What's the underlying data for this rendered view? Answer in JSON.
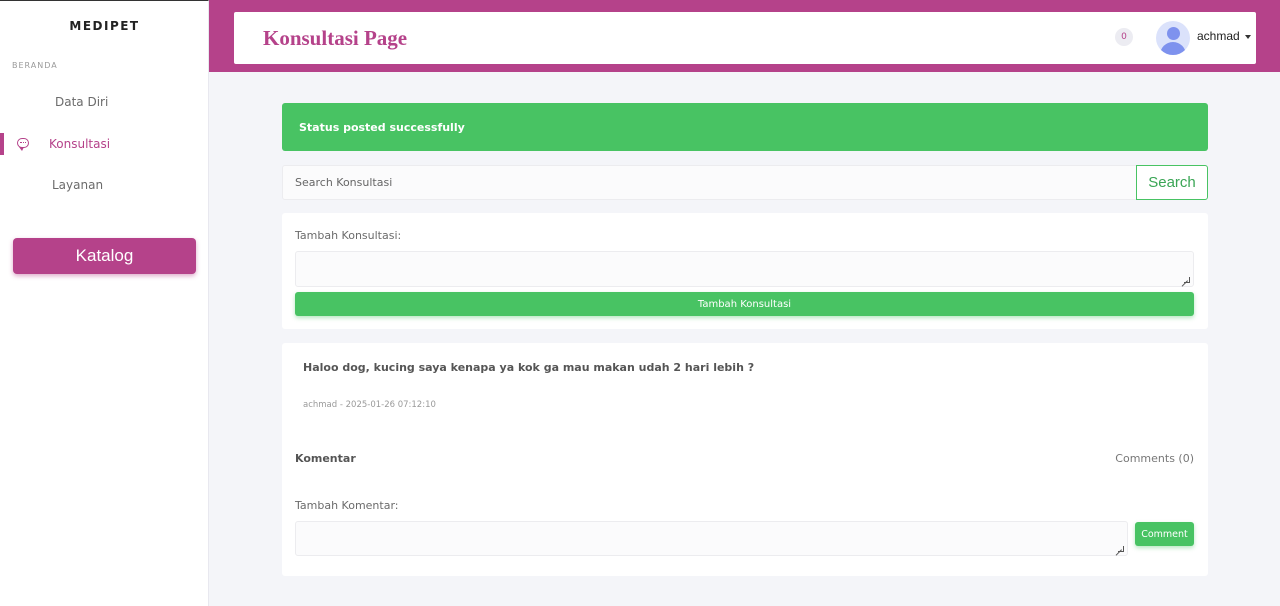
{
  "sidebar": {
    "brand": "MEDIPET",
    "section_label": "BERANDA",
    "items": [
      {
        "label": "Data Diri",
        "active": false
      },
      {
        "label": "Konsultasi",
        "active": true,
        "icon": "chat-bubble-icon"
      },
      {
        "label": "Layanan",
        "active": false
      }
    ],
    "katalog_label": "Katalog"
  },
  "header": {
    "title": "Konsultasi Page",
    "notification_count": "0",
    "username": "achmad"
  },
  "alert": {
    "message": "Status posted successfully"
  },
  "search": {
    "placeholder": "Search Konsultasi",
    "button_label": "Search"
  },
  "add_form": {
    "label": "Tambah Konsultasi:",
    "button_label": "Tambah Konsultasi"
  },
  "post": {
    "text": "Haloo dog, kucing saya kenapa ya kok ga mau makan udah 2 hari lebih ?",
    "meta": "achmad - 2025-01-26 07:12:10",
    "komentar_heading": "Komentar",
    "comments_count": "Comments (0)",
    "comment_label": "Tambah Komentar:",
    "comment_button": "Comment"
  },
  "colors": {
    "primary": "#b5428a",
    "success": "#48c363",
    "background": "#f4f5f9"
  }
}
